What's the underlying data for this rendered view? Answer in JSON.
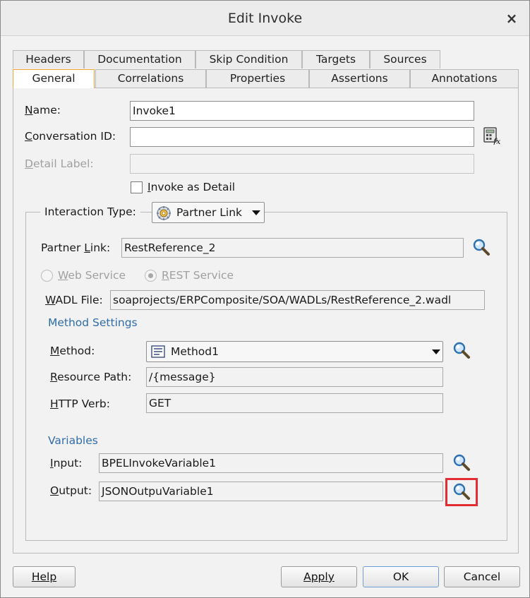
{
  "dialog": {
    "title": "Edit Invoke",
    "close_glyph": "×"
  },
  "tabs_top": [
    {
      "label": "Headers"
    },
    {
      "label": "Documentation"
    },
    {
      "label": "Skip Condition"
    },
    {
      "label": "Targets"
    },
    {
      "label": "Sources"
    }
  ],
  "tabs_bottom": [
    {
      "label": "General",
      "active": true
    },
    {
      "label": "Correlations"
    },
    {
      "label": "Properties"
    },
    {
      "label": "Assertions"
    },
    {
      "label": "Annotations"
    }
  ],
  "general": {
    "name_label": "Name:",
    "name_value": "Invoke1",
    "conversation_label": "Conversation ID:",
    "conversation_value": "",
    "detail_label": "Detail Label:",
    "detail_value": "",
    "invoke_as_detail_label": "Invoke as Detail",
    "invoke_as_detail_checked": false
  },
  "interaction": {
    "type_label": "Interaction Type:",
    "type_value": "Partner Link",
    "partner_link_label": "Partner Link:",
    "partner_link_value": "RestReference_2",
    "web_service_label": "Web Service",
    "rest_service_label": "REST Service",
    "wadl_label": "WADL File:",
    "wadl_value": "soaprojects/ERPComposite/SOA/WADLs/RestReference_2.wadl"
  },
  "method_settings": {
    "section_label": "Method Settings",
    "method_label": "Method:",
    "method_value": "Method1",
    "resource_path_label": "Resource Path:",
    "resource_path_value": "/{message}",
    "http_verb_label": "HTTP Verb:",
    "http_verb_value": "GET"
  },
  "variables": {
    "section_label": "Variables",
    "input_label": "Input:",
    "input_value": "BPELInvokeVariable1",
    "output_label": "Output:",
    "output_value": "JSONOutpuVariable1"
  },
  "footer": {
    "help_label": "Help",
    "apply_label": "Apply",
    "ok_label": "OK",
    "cancel_label": "Cancel"
  },
  "icons": {
    "search": "search-icon",
    "expression_builder": "expression-builder-icon",
    "partner_link": "partner-link-gear-icon",
    "method": "method-icon"
  },
  "colors": {
    "section_blue": "#2f6da8",
    "active_tab_border": "#f0a53a",
    "highlight_red": "#e22d35"
  }
}
